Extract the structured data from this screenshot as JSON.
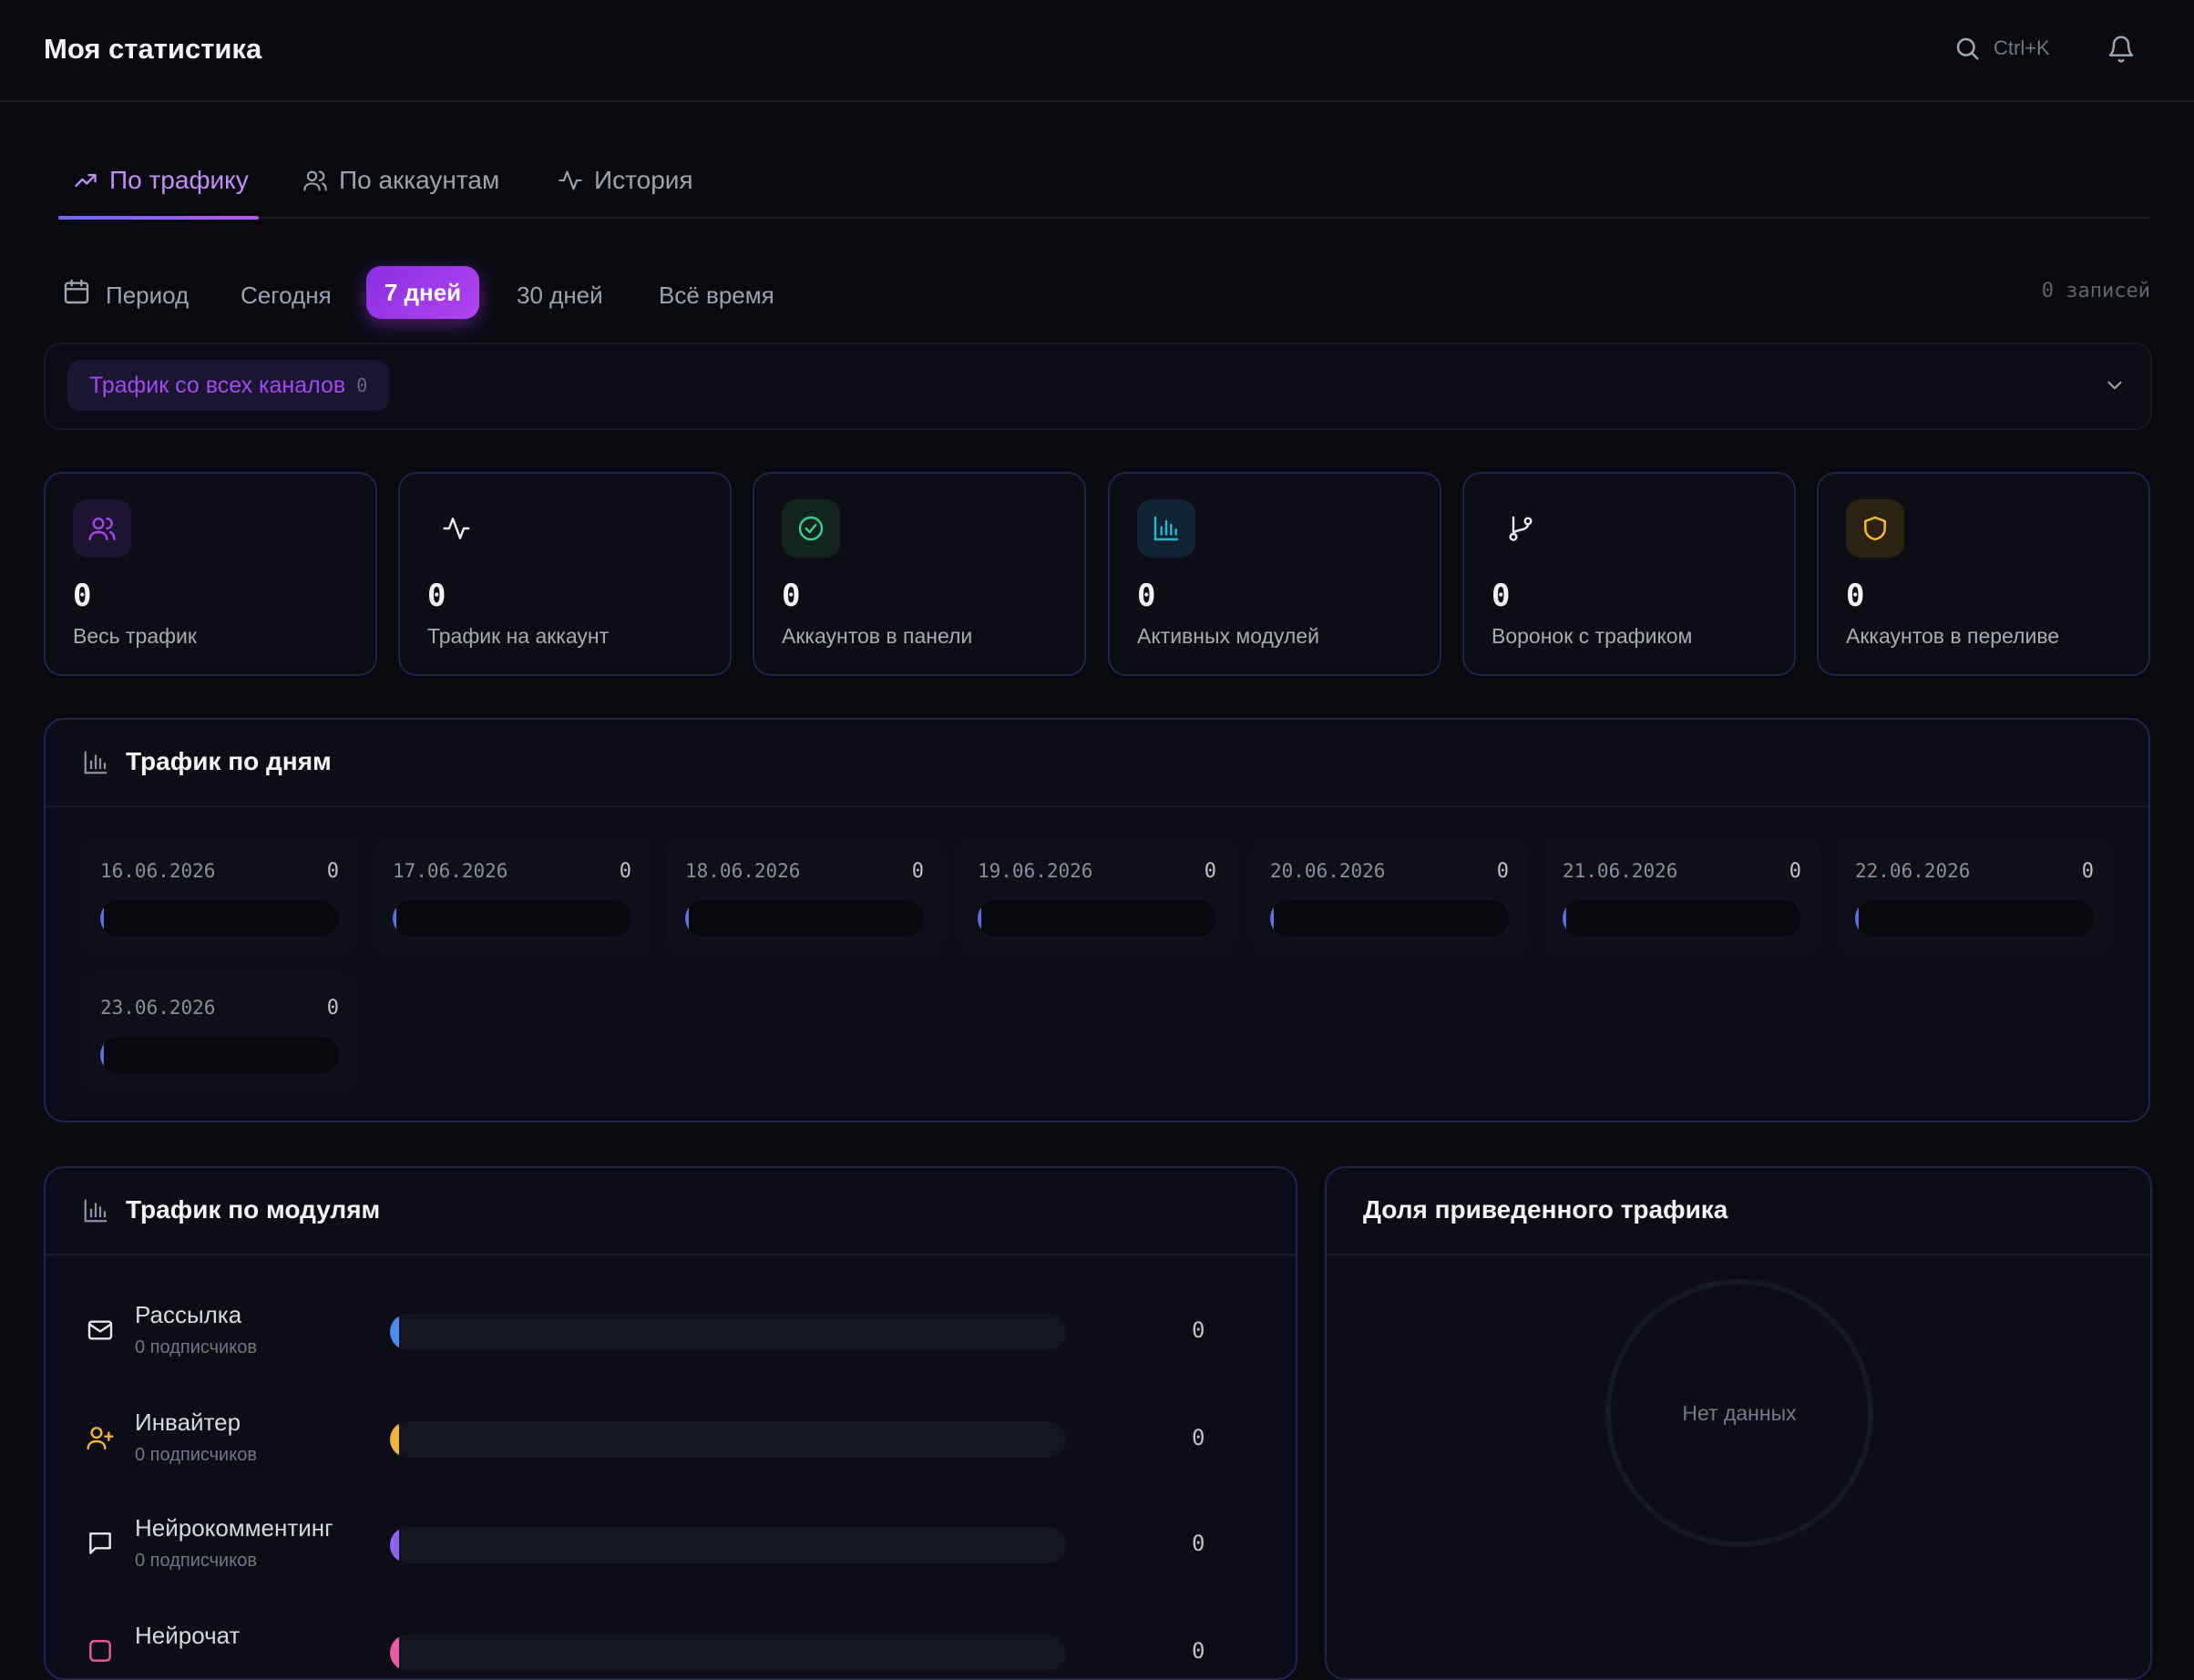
{
  "header": {
    "title": "Моя статистика",
    "search_shortcut": "Ctrl+K"
  },
  "tabs": [
    {
      "label": "По трафику",
      "active": true,
      "icon": "trending-up-icon"
    },
    {
      "label": "По аккаунтам",
      "active": false,
      "icon": "users-icon"
    },
    {
      "label": "История",
      "active": false,
      "icon": "activity-icon"
    }
  ],
  "filters": {
    "period_label": "Период",
    "options": [
      "Сегодня",
      "7 дней",
      "30 дней",
      "Всё время"
    ],
    "selected": "7 дней",
    "records": "0 записей"
  },
  "channel_filter": {
    "label": "Трафик со всех каналов",
    "count": "0"
  },
  "stats": [
    {
      "value": "0",
      "label": "Весь трафик",
      "icon": "users-icon",
      "color": "#a048f0"
    },
    {
      "value": "0",
      "label": "Трафик на аккаунт",
      "icon": "activity-icon",
      "color": "#e9eaf2"
    },
    {
      "value": "0",
      "label": "Аккаунтов в панели",
      "icon": "check-circle-icon",
      "color": "#3ecf8e"
    },
    {
      "value": "0",
      "label": "Активных модулей",
      "icon": "bar-chart-icon",
      "color": "#22b8d6"
    },
    {
      "value": "0",
      "label": "Воронок с трафиком",
      "icon": "git-branch-icon",
      "color": "#e9eaf2"
    },
    {
      "value": "0",
      "label": "Аккаунтов в переливе",
      "icon": "shield-icon",
      "color": "#f5b82e"
    }
  ],
  "daily": {
    "title": "Трафик по дням",
    "days": [
      {
        "date": "16.06.2026",
        "value": "0"
      },
      {
        "date": "17.06.2026",
        "value": "0"
      },
      {
        "date": "18.06.2026",
        "value": "0"
      },
      {
        "date": "19.06.2026",
        "value": "0"
      },
      {
        "date": "20.06.2026",
        "value": "0"
      },
      {
        "date": "21.06.2026",
        "value": "0"
      },
      {
        "date": "22.06.2026",
        "value": "0"
      },
      {
        "date": "23.06.2026",
        "value": "0"
      }
    ]
  },
  "modules": {
    "title": "Трафик по модулям",
    "items": [
      {
        "name": "Рассылка",
        "sub": "0 подписчиков",
        "value": "0",
        "icon": "mail-icon",
        "color": "#4b8ef0"
      },
      {
        "name": "Инвайтер",
        "sub": "0 подписчиков",
        "value": "0",
        "icon": "user-plus-icon",
        "color": "#f0b43a"
      },
      {
        "name": "Нейрокомментинг",
        "sub": "0 подписчиков",
        "value": "0",
        "icon": "message-square-icon",
        "color": "#8f63f0"
      },
      {
        "name": "Нейрочат",
        "sub": "",
        "value": "0",
        "icon": "chat-icon",
        "color": "#ea5aa0"
      }
    ]
  },
  "share": {
    "title": "Доля приведенного трафика",
    "empty": "Нет данных"
  }
}
